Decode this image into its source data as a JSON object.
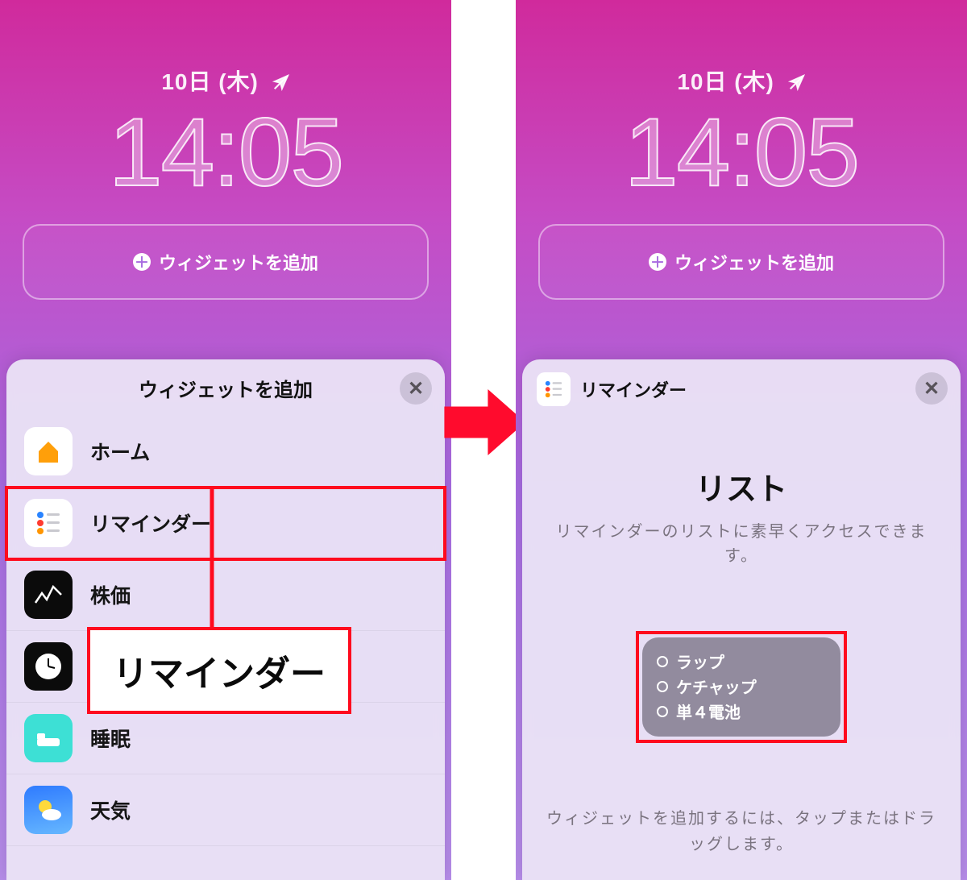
{
  "lockscreen": {
    "date": "10日 (木)",
    "time": "14:05",
    "add_widget_label": "ウィジェットを追加"
  },
  "left_sheet": {
    "title": "ウィジェットを追加",
    "apps": [
      {
        "name": "ホーム"
      },
      {
        "name": "リマインダー"
      },
      {
        "name": "株価"
      },
      {
        "name": "時計"
      },
      {
        "name": "睡眠"
      },
      {
        "name": "天気"
      }
    ],
    "callout": "リマインダー"
  },
  "right_sheet": {
    "app_name": "リマインダー",
    "title": "リスト",
    "desc": "リマインダーのリストに素早くアクセスできます。",
    "preview_items": [
      "ラップ",
      "ケチャップ",
      "単４電池"
    ],
    "hint": "ウィジェットを追加するには、タップまたはドラッグします。"
  }
}
